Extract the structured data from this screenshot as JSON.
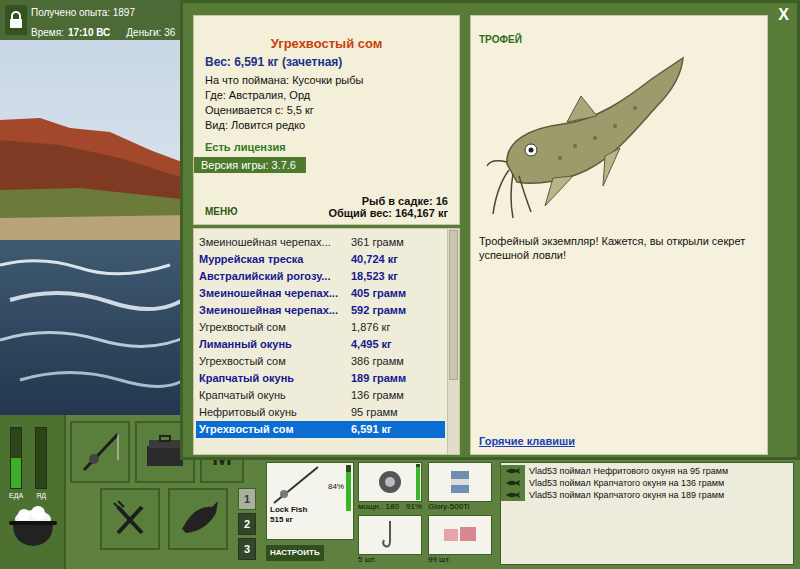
{
  "status": {
    "experience": "Получено опыта: 1897",
    "time_label": "Время:",
    "time": "17:10 ВС",
    "money": "Деньги: 36"
  },
  "close_button": "X",
  "trophy_card": {
    "title": "Угрехвостый сом",
    "weight": "Вес: 6,591 кг (зачетная)",
    "details": [
      "На что поймана: Кусочки рыбы",
      "Где: Австралия, Орд",
      "Оценивается с: 5,5 кг",
      "Вид: Ловится редко"
    ],
    "license": "Есть лицензия",
    "version": "Версия игры: 3.7.6",
    "menu": "МЕНЮ",
    "keepnet_count": "Рыб в садке: 16",
    "total_weight": "Общий вес: 164,167 кг"
  },
  "catch_list": {
    "scroll_level": 1,
    "rows": [
      {
        "name": "Змеиношейная черепах...",
        "weight": "361 грамм",
        "trophy": false,
        "selected": false
      },
      {
        "name": "Муррейская треска",
        "weight": "40,724 кг",
        "trophy": true,
        "selected": false
      },
      {
        "name": "Австралийский рогозу...",
        "weight": "18,523 кг",
        "trophy": true,
        "selected": false
      },
      {
        "name": "Змеиношейная черепах...",
        "weight": "405 грамм",
        "trophy": true,
        "selected": false
      },
      {
        "name": "Змеиношейная черепах...",
        "weight": "592 грамм",
        "trophy": true,
        "selected": false
      },
      {
        "name": "Угрехвостый сом",
        "weight": "1,876 кг",
        "trophy": false,
        "selected": false
      },
      {
        "name": "Лиманный окунь",
        "weight": "4,495 кг",
        "trophy": true,
        "selected": false
      },
      {
        "name": "Угрехвостый сом",
        "weight": "386 грамм",
        "trophy": false,
        "selected": false
      },
      {
        "name": "Крапчатый окунь",
        "weight": "189 грамм",
        "trophy": true,
        "selected": false
      },
      {
        "name": "Крапчатый окунь",
        "weight": "136 грамм",
        "trophy": false,
        "selected": false
      },
      {
        "name": "Нефритовый окунь",
        "weight": "95 грамм",
        "trophy": false,
        "selected": false
      },
      {
        "name": "Угрехвостый сом",
        "weight": "6,591 кг",
        "trophy": true,
        "selected": true
      }
    ]
  },
  "trophy_panel": {
    "badge": "ТРОФЕЙ",
    "message": "Трофейный экземпляр! Кажется, вы открыли секрет успешной ловли!",
    "hotkeys_link": "Горячие клавиши"
  },
  "meters": [
    {
      "label": "ЕДА",
      "level": 0.5
    },
    {
      "label": "ЯД",
      "level": 0
    }
  ],
  "map_button": "M",
  "tabs": [
    {
      "label": "1",
      "selected": true
    },
    {
      "label": "2",
      "selected": false
    },
    {
      "label": "3",
      "selected": false
    }
  ],
  "tackle": {
    "rod": {
      "condition": "84%",
      "level": 0.84,
      "name": "Lock Fish",
      "capacity": "515 кг",
      "button": "НАСТРОИТЬ"
    },
    "reel": {
      "power": "мощн.: 180",
      "condition": "91%",
      "level": 0.91
    },
    "line": {
      "name": "Glory-500Ti"
    },
    "hook": {
      "count": "5 шт."
    },
    "bait": {
      "count": "99 шт."
    }
  },
  "chat": [
    "Vlad53 поймал Нефритового окуня на 95 грамм",
    "Vlad53 поймал Крапчатого окуня на 136 грамм",
    "Vlad53 поймал Крапчатого окуня на 189 грамм"
  ]
}
